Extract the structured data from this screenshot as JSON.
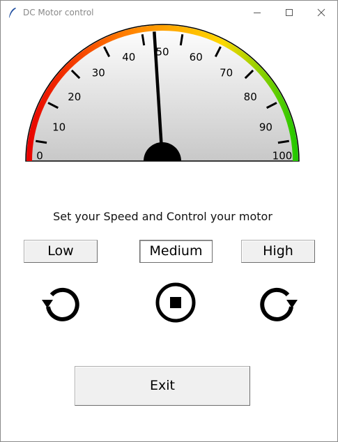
{
  "window": {
    "title": "DC Motor control",
    "icon": "feather-icon",
    "controls": [
      "minimize-icon",
      "maximize-icon",
      "close-icon"
    ]
  },
  "gauge": {
    "min": 0,
    "max": 100,
    "value": 48,
    "major_labels": [
      "0",
      "10",
      "20",
      "30",
      "40",
      "50",
      "60",
      "70",
      "80",
      "90",
      "100"
    ],
    "colors": {
      "low": "#e80000",
      "mid_low": "#ff7a00",
      "mid_high": "#ffd800",
      "high": "#1ec800",
      "face_top": "#ffffff",
      "face_bottom": "#c8c8c8",
      "needle": "#000000"
    }
  },
  "prompt": "Set your Speed and Control your motor",
  "speed_buttons": {
    "low": "Low",
    "medium": "Medium",
    "high": "High",
    "selected": "Medium"
  },
  "motor_controls": {
    "ccw_icon": "rotate-counterclockwise-icon",
    "stop_icon": "stop-icon",
    "cw_icon": "rotate-clockwise-icon"
  },
  "exit_button": "Exit"
}
